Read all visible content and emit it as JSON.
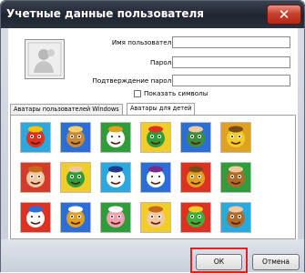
{
  "window": {
    "title": "Учетные данные пользователя"
  },
  "titlebar": {
    "close_icon": "close-x-icon"
  },
  "form": {
    "username_label": "Имя пользователя:",
    "username_value": "",
    "password_label": "Пароль:",
    "password_value": "",
    "confirm_label": "Подтверждение пароля:",
    "confirm_value": "",
    "show_chars_label": "Показать символы",
    "show_chars_checked": false
  },
  "tabs": [
    {
      "label": "Аватары пользователей Windows",
      "active": false
    },
    {
      "label": "Аватары для детей",
      "active": true
    }
  ],
  "avatars": [
    [
      "flower",
      "dog",
      "stork",
      "caterpillar",
      "soldier",
      "cat-gold"
    ],
    [
      "girl",
      "gnome",
      "sailor",
      "cow",
      "lion",
      "monkey"
    ],
    [
      "cat-sailor",
      "bird",
      "pig",
      "girl-face",
      "snake",
      "monkey-brown"
    ]
  ],
  "buttons": {
    "ok_label": "ОК",
    "cancel_label": "Отмена"
  },
  "colors": {
    "titlebar": "#1f2530",
    "close_button": "#c8412e",
    "highlight": "#e0241b"
  }
}
